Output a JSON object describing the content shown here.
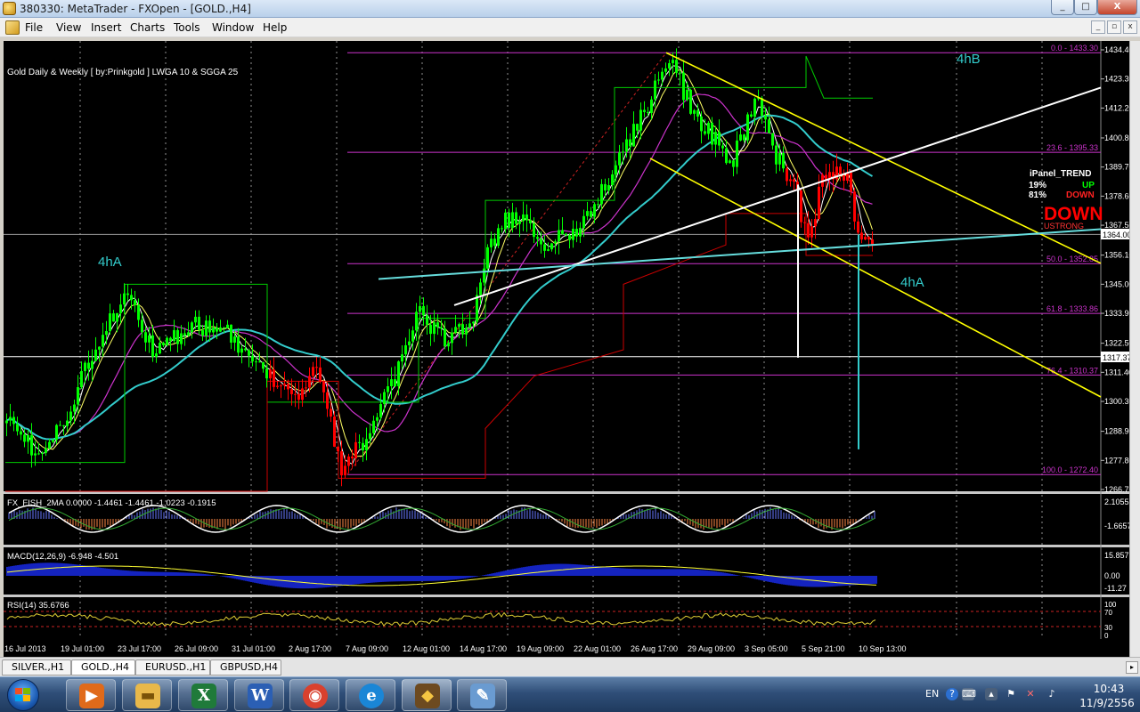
{
  "window": {
    "title": "380330: MetaTrader - FXOpen - [GOLD.,H4]",
    "min_glyph": "_",
    "max_glyph": "□",
    "close_glyph": "X"
  },
  "menu": {
    "items": [
      "File",
      "View",
      "Insert",
      "Charts",
      "Tools",
      "Window",
      "Help"
    ],
    "mdi": [
      "_",
      "▫",
      "x"
    ]
  },
  "chart": {
    "info": "Gold Daily & Weekly [ by:Prinkgold ] LWGA 10  &  SGGA 25",
    "price_axis": [
      "1434.40",
      "1423.30",
      "1412.20",
      "1400.80",
      "1389.70",
      "1378.60",
      "1367.50",
      "1356.10",
      "1345.00",
      "1333.90",
      "1322.50",
      "1311.40",
      "1300.30",
      "1288.90",
      "1277.80",
      "1266.70"
    ],
    "price_box_1": "1364.00",
    "price_box_2": "1317.37",
    "fibo": [
      {
        "label": "0.0 - 1433.30"
      },
      {
        "label": "23.6 - 1395.33"
      },
      {
        "label": "50.0 - 1352.85"
      },
      {
        "label": "61.8 - 1333.86"
      },
      {
        "label": "76.4 - 1310.37"
      },
      {
        "label": "100.0 - 1272.40"
      }
    ],
    "fibo_color": "#cc33cc",
    "labels": {
      "hB": "4hB",
      "hA_left": "4hA",
      "hA_right": "4hA"
    },
    "ipanel": {
      "title": "iPanel_TREND",
      "pct_up": "19%",
      "up": "UP",
      "pct_down": "81%",
      "down": "DOWN",
      "big": "DOWN",
      "strong": "USTRONG"
    },
    "dates": [
      "16 Jul 2013",
      "19 Jul 01:00",
      "23 Jul 17:00",
      "26 Jul 09:00",
      "31 Jul 01:00",
      "2 Aug 17:00",
      "7 Aug 09:00",
      "12 Aug 01:00",
      "14 Aug 17:00",
      "19 Aug 09:00",
      "22 Aug 01:00",
      "26 Aug 17:00",
      "29 Aug 09:00",
      "3 Sep 05:00",
      "5 Sep 21:00",
      "10 Sep 13:00"
    ],
    "colors": {
      "bull": "#00ff00",
      "bear": "#ff0000",
      "cyan": "#33cccc",
      "yellow": "#ffff00",
      "magenta": "#cc33cc",
      "sar_red": "#cc0000",
      "ma_green": "#00cc00"
    }
  },
  "fish": {
    "label": "FX_FISH_2MA 0.0000 -1.4461 -1.4461 -1.0223 -0.1915",
    "axis": [
      "2.1055",
      "-1.6657"
    ]
  },
  "macd": {
    "label": "MACD(12,26,9) -6.948 -4.501",
    "axis": [
      "15.857",
      "0.00",
      "-11.27"
    ]
  },
  "rsi": {
    "label": "RSI(14) 35.6766",
    "axis": [
      "100",
      "70",
      "30",
      "0"
    ]
  },
  "tabs": [
    "SILVER.,H1",
    "GOLD.,H4",
    "EURUSD.,H1",
    "GBPUSD,H4"
  ],
  "active_tab": "GOLD.,H4",
  "taskbar": {
    "apps": [
      {
        "icon": "media-player-icon",
        "glyph": "▶"
      },
      {
        "icon": "explorer-folder-icon",
        "glyph": "▬"
      },
      {
        "icon": "excel-icon",
        "glyph": "X"
      },
      {
        "icon": "word-icon",
        "glyph": "W"
      },
      {
        "icon": "chrome-icon",
        "glyph": "◉"
      },
      {
        "icon": "internet-explorer-icon",
        "glyph": "e"
      },
      {
        "icon": "metatrader-icon",
        "glyph": "◆"
      },
      {
        "icon": "paint-icon",
        "glyph": "✎"
      }
    ],
    "lang": "EN",
    "time": "10:43",
    "date": "11/9/2556"
  }
}
